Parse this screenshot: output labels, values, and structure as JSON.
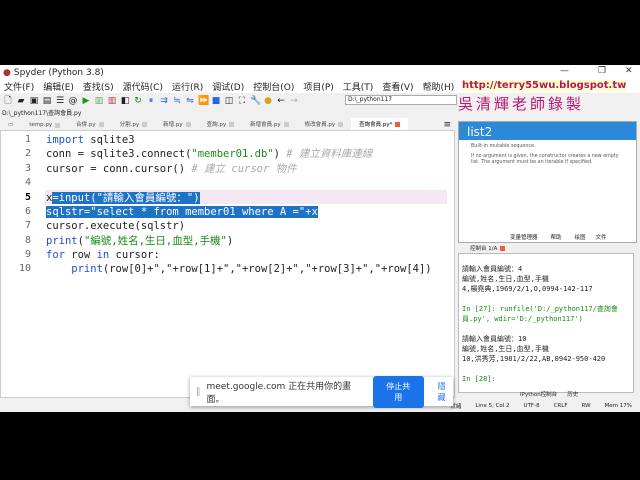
{
  "window": {
    "title": "Spyder (Python 3.8)",
    "minimize": "—",
    "restore": "❐",
    "close": "✕"
  },
  "menu": [
    "文件(F)",
    "编辑(E)",
    "查找(S)",
    "源代码(C)",
    "运行(R)",
    "调试(D)",
    "控制台(O)",
    "项目(P)",
    "工具(T)",
    "查看(V)",
    "帮助(H)"
  ],
  "toolbar": {
    "path": "D:\\_python117"
  },
  "file_path": "D:\\_python117\\查詢會員.py",
  "tabs": [
    "temp.py",
    "合併.py",
    "分割.py",
    "新增.py",
    "查詢.py",
    "新增會員.py",
    "修改會員.py",
    "查詢會員.py*"
  ],
  "editor": {
    "lines": [
      "1",
      "2",
      "3",
      "4",
      "5",
      "6",
      "7",
      "8",
      "9",
      "10"
    ]
  },
  "code": {
    "l1a": "import",
    "l1b": " sqlite3",
    "l2a": "conn = sqlite3.connect(",
    "l2b": "\"member01.db\"",
    "l2c": ") ",
    "l2d": "# 建立資料庫連線",
    "l3a": "cursor = conn.cursor() ",
    "l3b": "# 建立 cursor 物件",
    "l5a": "x",
    "l5b": "=input(\"請輸入會員編號：\")",
    "l6": "sqlstr=\"select * from member01 where A =\"+x",
    "l7": "cursor.execute(sqlstr)",
    "l8a": "print",
    "l8b": "(",
    "l8c": "\"編號,姓名,生日,血型,手機\"",
    "l8d": ")",
    "l9a": "for",
    "l9b": " row ",
    "l9c": "in",
    "l9d": " cursor:",
    "l10a": "    print",
    "l10b": "(row[0]+\",\"+row[1]+\",\"+row[2]+\",\"+row[3]+\",\"+row[4])"
  },
  "help": {
    "title": "list2",
    "desc1": "Built-in mutable sequence.",
    "desc2": "If no argument is given, the constructor creates a new empty list. The argument must be an iterable if specified."
  },
  "right_tabs": [
    "变量管理器",
    "帮助",
    "绘图",
    "文件"
  ],
  "console": {
    "tab": "控制台 1/A",
    "lines": [
      "請輸入會員編號：4",
      "編號,姓名,生日,血型,手機",
      "4,楊堯典,1969/2/1,O,0994-142-117",
      "",
      "In [27]: runfile('D:/_python117/查詢會員.py', wdir='D:/_python117')",
      "",
      "請輸入會員編號：10",
      "編號,姓名,生日,血型,手機",
      "10,洪秀芳,1981/2/22,AB,0942-950-420",
      "",
      "In [28]:"
    ]
  },
  "bottom_tabs": [
    "IPython控制台",
    "历史"
  ],
  "status": [
    "就緒",
    "Line 5, Col 2",
    "UTF-8",
    "CRLF",
    "RW",
    "Mem 17%"
  ],
  "share_bar": {
    "message": "meet.google.com 正在共用你的畫面。",
    "stop": "停止共用",
    "hide": "隱藏"
  },
  "watermark": {
    "url": "http://terry55wu.blogspot.tw",
    "name": "吳清輝老師錄製"
  }
}
